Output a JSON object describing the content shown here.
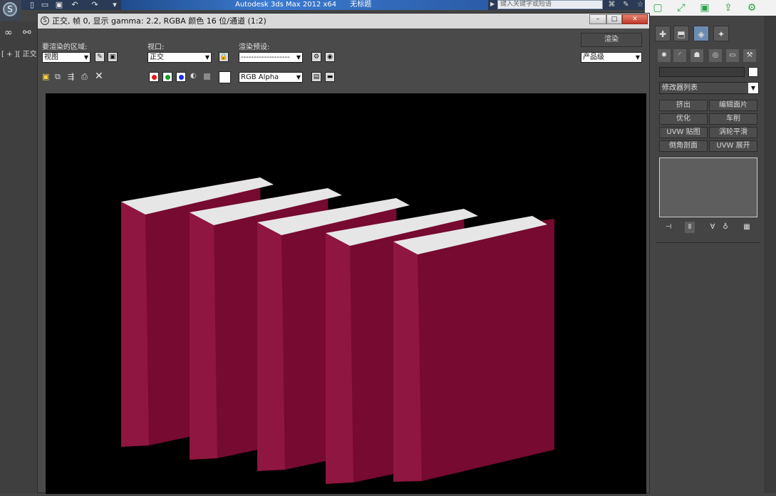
{
  "app": {
    "title": "Autodesk 3ds Max  2012 x64",
    "doc": "无标题",
    "search_placeholder": "键入关键字或短语"
  },
  "viewport": {
    "label": "[ + ][ 正交"
  },
  "render_window": {
    "title": "正交, 帧 0, 显示 gamma: 2.2, RGBA 颜色 16 位/通道 (1:2)",
    "area_label": "要渲染的区域:",
    "area_value": "视图",
    "viewport_label": "视口:",
    "viewport_value": "正交",
    "preset_label": "渲染预设:",
    "preset_value": "-------------------",
    "render_button": "渲染",
    "quality_value": "产品级",
    "channel_value": "RGB Alpha"
  },
  "command_panel": {
    "modifier_list": "修改器列表",
    "buttons": [
      "挤出",
      "编辑面片",
      "优化",
      "车削",
      "UVW 贴图",
      "涡轮平滑",
      "倒角剖面",
      "UVW 展开"
    ]
  },
  "icons": {
    "minimize": "minimize-icon",
    "restore": "restore-icon",
    "close": "close-icon"
  },
  "colors": {
    "book_cover": "#7a0b33",
    "book_spine": "#8e1640",
    "pages": "#e6e6e6",
    "canvas_bg": "#000000"
  }
}
